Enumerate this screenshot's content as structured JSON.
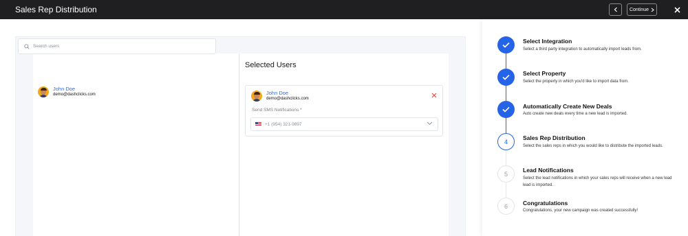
{
  "header": {
    "title": "Sales Rep Distribution",
    "back_icon": "chevron-left-icon",
    "continue_label": "Continue",
    "close_icon": "close-icon"
  },
  "users": {
    "search_placeholder": "Search users",
    "list": [
      {
        "name": "John Doe",
        "email": "demo@dashclicks.com"
      }
    ]
  },
  "selected": {
    "title": "Selected Users",
    "cards": [
      {
        "name": "John Doe",
        "email": "demo@dashclicks.com",
        "sms_label": "Send SMS Notifications *",
        "phone": "+1 (954) 321-9897",
        "flag": "us-flag-icon"
      }
    ]
  },
  "steps": [
    {
      "number": "1",
      "title": "Select Integration",
      "desc": "Select a third party integration to automatically import leads from.",
      "status": "done"
    },
    {
      "number": "2",
      "title": "Select Property",
      "desc": "Select the property in which you'd like to import data from.",
      "status": "done"
    },
    {
      "number": "3",
      "title": "Automatically Create New Deals",
      "desc": "Auto create new deals every time a new lead is imported.",
      "status": "done"
    },
    {
      "number": "4",
      "title": "Sales Rep Distribution",
      "desc": "Select the sales reps in which you would like to distribute the imported leads.",
      "status": "current"
    },
    {
      "number": "5",
      "title": "Lead Notifications",
      "desc": "Select the lead notifications in which your sales reps will receive when a new lead lead is imported.",
      "status": "todo"
    },
    {
      "number": "6",
      "title": "Congratulations",
      "desc": "Congratulations, your new campaign was created successfully!",
      "status": "todo"
    }
  ],
  "colors": {
    "accent": "#2563e7",
    "topbar": "#1f1f21",
    "remove": "#e24a3b"
  }
}
